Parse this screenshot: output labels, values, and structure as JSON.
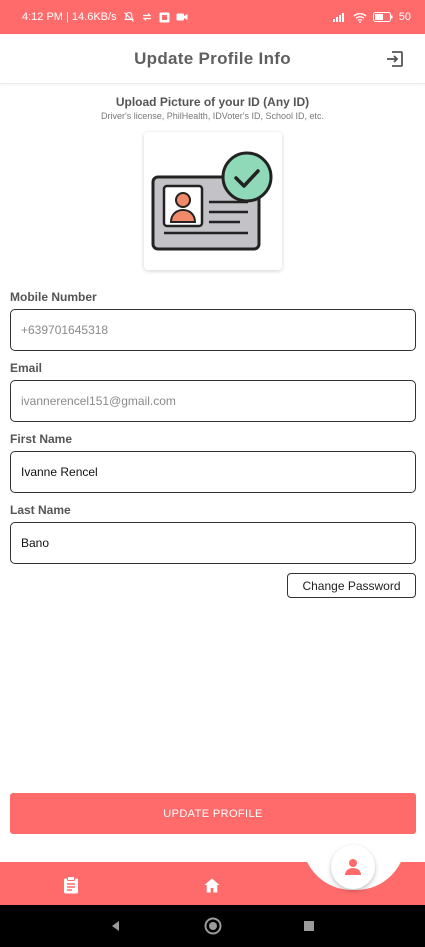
{
  "status_bar": {
    "time_speed": "4:12 PM | 14.6KB/s",
    "battery": "50",
    "icons": [
      "mute-icon",
      "sync-icon",
      "app-icon",
      "video-icon",
      "signal-icon",
      "wifi-icon",
      "battery-icon"
    ]
  },
  "header": {
    "title": "Update Profile Info",
    "logout_icon": "logout-icon"
  },
  "upload": {
    "title": "Upload Picture of your ID (Any ID)",
    "subtitle": "Driver's license, PhilHealth, IDVoter's ID, School ID, etc.",
    "image_icon": "id-card-verified-icon"
  },
  "form": {
    "mobile": {
      "label": "Mobile Number",
      "value": "+639701645318"
    },
    "email": {
      "label": "Email",
      "value": "ivannerencel151@gmail.com"
    },
    "first_name": {
      "label": "First Name",
      "value": "Ivanne Rencel"
    },
    "last_name": {
      "label": "Last Name",
      "value": "Bano"
    },
    "change_password_label": "Change Password"
  },
  "actions": {
    "update_label": "UPDATE PROFILE"
  },
  "bottom_nav": {
    "items": [
      {
        "icon": "clipboard-icon"
      },
      {
        "icon": "home-icon"
      },
      {
        "icon": "person-icon",
        "active": true
      }
    ]
  },
  "colors": {
    "accent": "#ff6b6b",
    "check": "#8fd8b8",
    "card_face": "#c3c3c7"
  }
}
